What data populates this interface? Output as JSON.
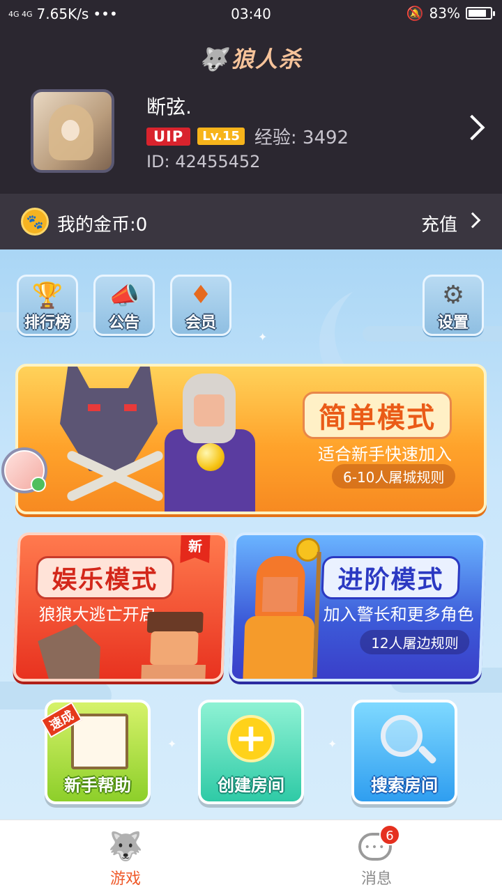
{
  "status_bar": {
    "network": "4G 4G",
    "speed": "7.65K/s",
    "more": "•••",
    "time": "03:40",
    "battery": "83%",
    "battery_level": 0.83
  },
  "app": {
    "title": "狼人杀"
  },
  "profile": {
    "name": "断弦.",
    "vip": "UIP",
    "level": "Lv.15",
    "exp": "经验: 3492",
    "id": "ID: 42455452"
  },
  "coins": {
    "label": "我的金币:0",
    "recharge": "充值"
  },
  "top_icons": [
    {
      "label": "排行榜",
      "icon": "trophy-icon"
    },
    {
      "label": "公告",
      "icon": "megaphone-icon"
    },
    {
      "label": "会员",
      "icon": "vip-badge-icon"
    },
    {
      "label": "设置",
      "icon": "gear-icon"
    }
  ],
  "modes": {
    "simple": {
      "title": "简单模式",
      "desc": "适合新手快速加入",
      "rule": "6-10人屠城规则"
    },
    "fun": {
      "title": "娱乐模式",
      "desc": "狼狼大逃亡开启",
      "tag": "新"
    },
    "advanced": {
      "title": "进阶模式",
      "desc": "加入警长和更多角色",
      "rule": "12人屠边规则"
    }
  },
  "bottom_tiles": {
    "help": {
      "label": "新手帮助",
      "tag": "速成"
    },
    "create": {
      "label": "创建房间"
    },
    "search": {
      "label": "搜索房间"
    }
  },
  "nav": {
    "game": "游戏",
    "messages": "消息",
    "messages_badge": "6"
  },
  "colors": {
    "header_bg": "#2b2730",
    "accent": "#ef5a2a",
    "vip_red": "#d9232d",
    "level_yellow": "#f7b41b"
  }
}
